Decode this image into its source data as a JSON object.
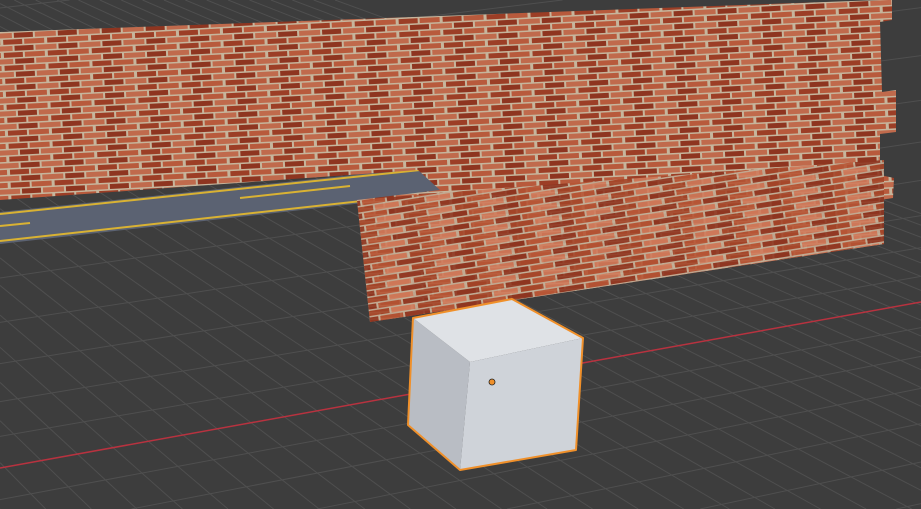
{
  "viewport": {
    "background_color": "#3d3d3d",
    "grid_color": "#4f4f4f",
    "x_axis_color": "#b8323f",
    "selection_outline_color": "#f0902a",
    "mortar_color": "#c6b59c",
    "road_color": "#5b6272",
    "road_line_color": "#d9b233",
    "cube_colors": {
      "top": "#dfe2e6",
      "left": "#b9bdc4",
      "front": "#cfd3d9"
    }
  },
  "scene_objects": [
    {
      "name": "brick-wall"
    },
    {
      "name": "road-plane"
    },
    {
      "name": "cube",
      "selected": true
    }
  ],
  "icons": {
    "origin": "object-origin-icon"
  }
}
